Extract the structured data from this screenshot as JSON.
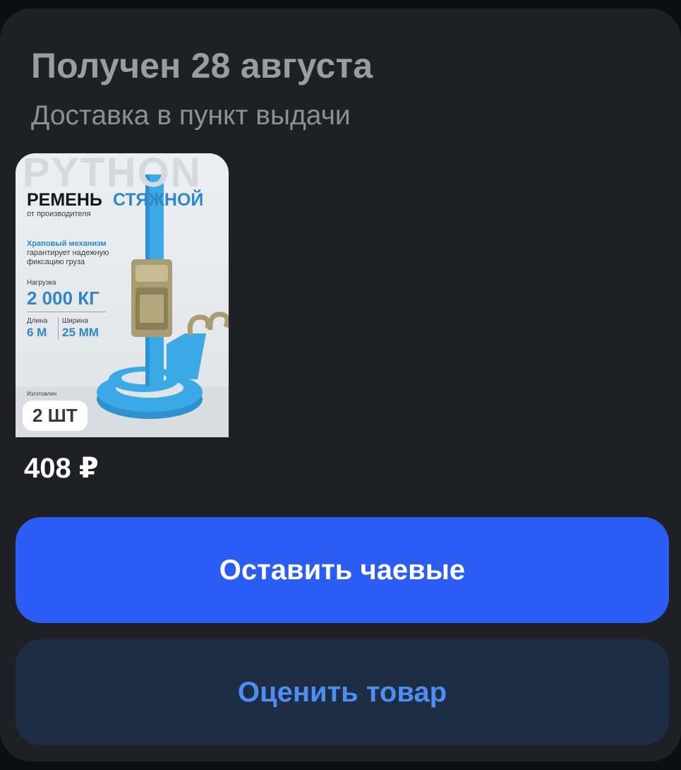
{
  "order": {
    "title": "Получен 28 августа",
    "subtitle": "Доставка в пункт выдачи"
  },
  "product": {
    "quantity_badge": "2 ШТ",
    "price": "408 ₽",
    "image": {
      "brand_watermark": "PYTHON",
      "heading_part1": "РЕМЕНЬ",
      "heading_part2": "СТЯЖНОЙ",
      "from_manufacturer": "от производителя",
      "mechanism_title": "Храповый механизм",
      "mechanism_line1": "гарантирует надежную",
      "mechanism_line2": "фиксацию груза",
      "load_label": "Нагрузка",
      "load_value": "2 000 КГ",
      "length_label": "Длина",
      "length_value": "6 М",
      "width_label": "Ширина",
      "width_value": "25 ММ",
      "made_label": "Изготовлен"
    }
  },
  "actions": {
    "tip_label": "Оставить чаевые",
    "rate_label": "Оценить товар"
  },
  "colors": {
    "card_bg": "#1f2025",
    "primary_button": "#2b5cf3",
    "secondary_button": "#1e2c44",
    "secondary_text": "#4d8ef0",
    "strap_blue": "#3aa9e6"
  }
}
